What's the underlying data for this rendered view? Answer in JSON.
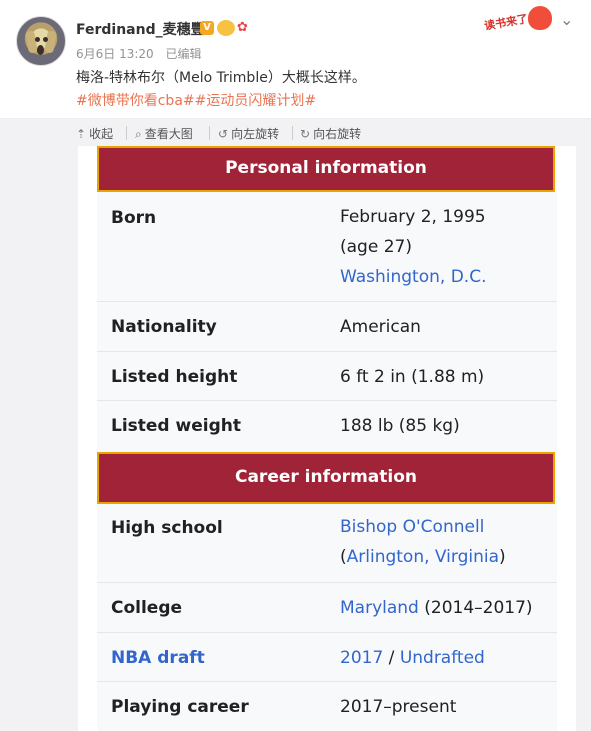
{
  "post": {
    "username": "Ferdinand_麦穗豐",
    "verified_badge": "V",
    "date": "6月6日 13:20",
    "edited": "已编辑",
    "text": "梅洛-特林布尔（Melo Trimble）大概长这样。",
    "tags": [
      "#微博带你看cba#",
      "#运动员闪耀计划#"
    ],
    "decor_text": "读书来了"
  },
  "toolbar": {
    "collapse": "收起",
    "view_large": "查看大图",
    "rotate_left": "向左旋转",
    "rotate_right": "向右旋转"
  },
  "infobox": {
    "personal_header": "Personal information",
    "born_label": "Born",
    "born_date": "February 2, 1995",
    "born_age": "(age 27)",
    "born_place": "Washington, D.C.",
    "nationality_label": "Nationality",
    "nationality_value": "American",
    "height_label": "Listed height",
    "height_value": "6 ft 2 in (1.88 m)",
    "weight_label": "Listed weight",
    "weight_value": "188 lb (85 kg)",
    "career_header": "Career information",
    "hs_label": "High school",
    "hs_name": "Bishop O'Connell",
    "hs_open": "(",
    "hs_location": "Arlington, Virginia",
    "hs_close": ")",
    "college_label": "College",
    "college_name": "Maryland",
    "college_years": "(2014–2017)",
    "draft_label": "NBA draft",
    "draft_year": "2017",
    "draft_sep": " / ",
    "draft_status": "Undrafted",
    "career_label": "Playing career",
    "career_value": "2017–present"
  },
  "colors": {
    "header_bg": "#a12338",
    "header_border": "#e8a400",
    "link": "#3366cc",
    "tag": "#eb7350"
  }
}
